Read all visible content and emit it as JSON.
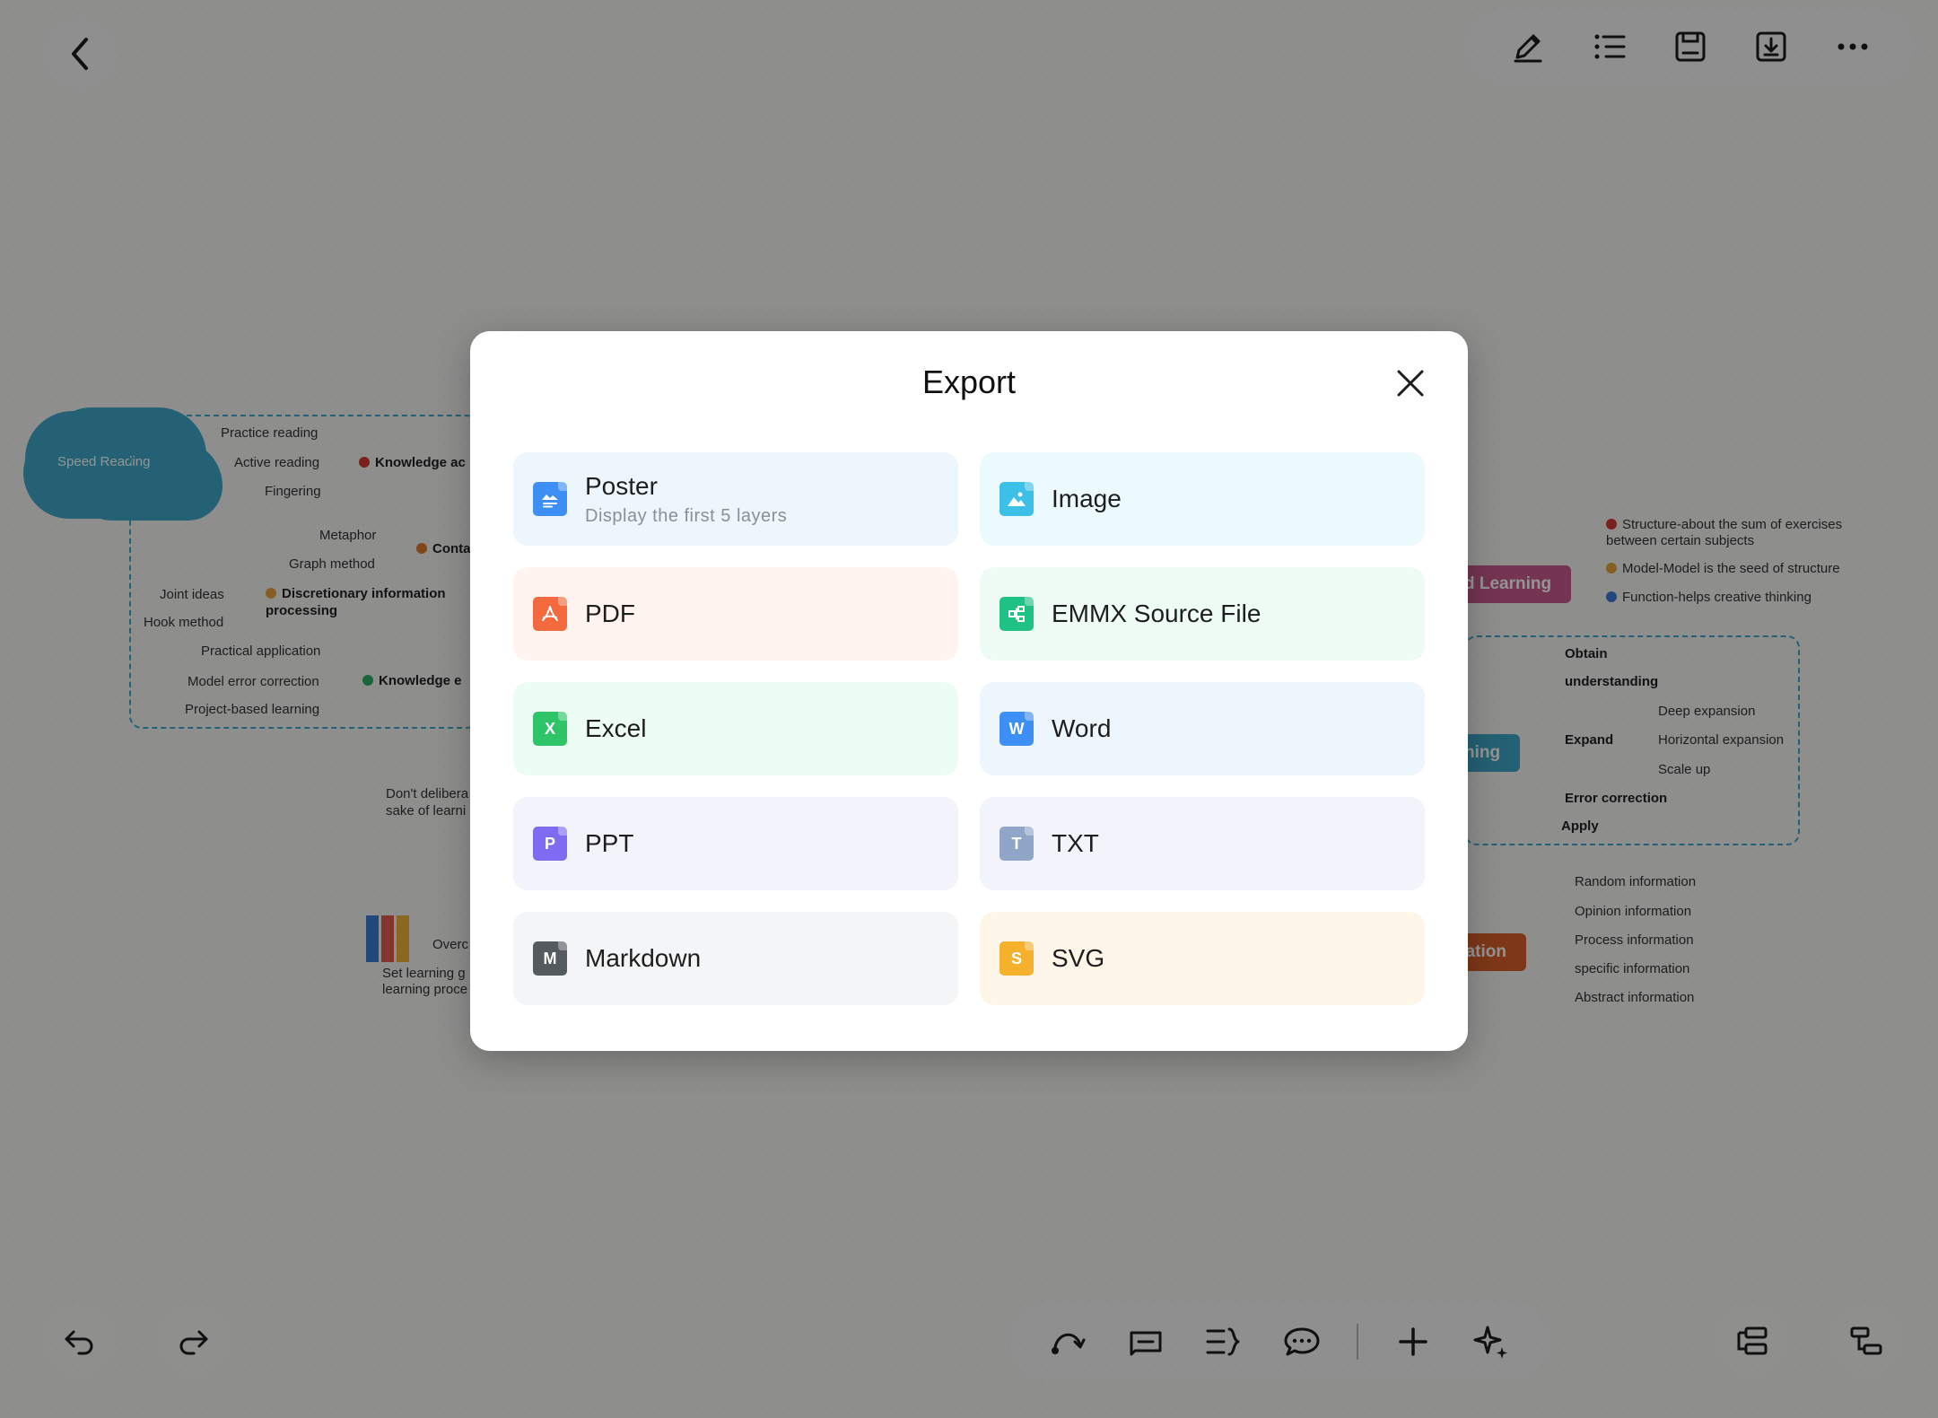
{
  "colors": {
    "accent_blue": "#3fa7c9",
    "pink_topic": "#c85a8e",
    "orange_topic": "#d9602a",
    "modal_bg": "#ffffff"
  },
  "toolbar": {
    "back_icon": "chevron-left-icon",
    "tools": [
      "pen-icon",
      "outline-list-icon",
      "save-icon",
      "download-icon",
      "more-icon"
    ]
  },
  "mindmap": {
    "central_left": "Speed Reading",
    "left_items": [
      "Practice reading",
      "Active reading",
      "Fingering",
      "Metaphor",
      "Graph method",
      "Joint ideas",
      "Hook method",
      "Practical application",
      "Model error correction",
      "Project-based learning"
    ],
    "left_topics": [
      "Knowledge ac",
      "Conta",
      "Discretionary information processing",
      "Knowledge e"
    ],
    "left_notes": [
      "Don't delibera",
      "sake of learni",
      "Overc",
      "Set learning g",
      "learning proce"
    ],
    "right_topics": [
      "d Learning",
      "ning",
      "nation"
    ],
    "right_group1": [
      "Structure-about the sum of exercises between certain subjects",
      "Model-Model is the seed of structure",
      "Function-helps creative thinking"
    ],
    "right_group2": [
      "Obtain",
      "understanding",
      "Expand",
      "Deep expansion",
      "Horizontal expansion",
      "Scale up",
      "Error correction",
      "Apply"
    ],
    "right_group3": [
      "Random information",
      "Opinion information",
      "Process information",
      "specific information",
      "Abstract information"
    ]
  },
  "modal": {
    "title": "Export",
    "options": [
      {
        "label": "Poster",
        "sub": "Display the first 5 layers",
        "icon": "poster-icon",
        "glyph": "",
        "color": "#3d8ef5",
        "bg": "#eef6fd"
      },
      {
        "label": "Image",
        "sub": "",
        "icon": "image-icon",
        "glyph": "",
        "color": "#3dc0e8",
        "bg": "#ecfafd"
      },
      {
        "label": "PDF",
        "sub": "",
        "icon": "pdf-icon",
        "glyph": "",
        "color": "#f26a3d",
        "bg": "#fff4ef"
      },
      {
        "label": "EMMX Source File",
        "sub": "",
        "icon": "emmx-icon",
        "glyph": "",
        "color": "#1fc284",
        "bg": "#eefcf5"
      },
      {
        "label": "Excel",
        "sub": "",
        "icon": "excel-icon",
        "glyph": "X",
        "color": "#2fc468",
        "bg": "#eefdf3"
      },
      {
        "label": "Word",
        "sub": "",
        "icon": "word-icon",
        "glyph": "W",
        "color": "#3d8ef5",
        "bg": "#eef6fd"
      },
      {
        "label": "PPT",
        "sub": "",
        "icon": "ppt-icon",
        "glyph": "P",
        "color": "#7d6cf2",
        "bg": "#f3f3fc"
      },
      {
        "label": "TXT",
        "sub": "",
        "icon": "txt-icon",
        "glyph": "T",
        "color": "#8fa6c8",
        "bg": "#f1f5fb"
      },
      {
        "label": "Markdown",
        "sub": "",
        "icon": "markdown-icon",
        "glyph": "M",
        "color": "#555a60",
        "bg": "#f4f5f6"
      },
      {
        "label": "SVG",
        "sub": "",
        "icon": "svg-icon",
        "glyph": "S",
        "color": "#f5b02e",
        "bg": "#fff6ea"
      }
    ]
  },
  "bottom": {
    "undo_icon": "undo-icon",
    "redo_icon": "redo-icon",
    "tools": [
      "relationship-curve-icon",
      "callout-icon",
      "summary-icon",
      "comment-icon",
      "add-icon",
      "ai-sparkle-icon"
    ],
    "right_tools": [
      "layout-icon",
      "structure-icon"
    ]
  }
}
